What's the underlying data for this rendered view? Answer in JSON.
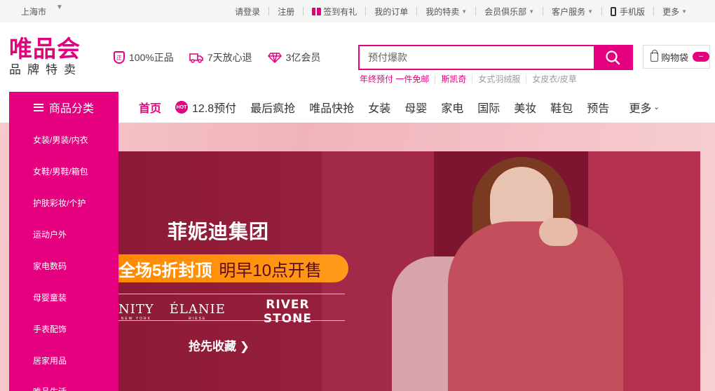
{
  "topbar": {
    "city": "上海市",
    "links": [
      {
        "label": "请登录"
      },
      {
        "label": "注册"
      },
      {
        "label": "签到有礼",
        "icon": "gift-icon"
      },
      {
        "label": "我的订单"
      },
      {
        "label": "我的特卖",
        "dropdown": true
      },
      {
        "label": "会员俱乐部",
        "dropdown": true
      },
      {
        "label": "客户服务",
        "dropdown": true
      },
      {
        "label": "手机版",
        "icon": "phone-icon"
      },
      {
        "label": "更多",
        "dropdown": true
      }
    ]
  },
  "logo": {
    "line1": "唯品会",
    "line2": "品牌特卖"
  },
  "promises": [
    {
      "label": "100%正品",
      "icon": "shield-badge-icon",
      "badge_text": "正"
    },
    {
      "label": "7天放心退",
      "icon": "truck-icon"
    },
    {
      "label": "3亿会员",
      "icon": "diamond-icon"
    }
  ],
  "search": {
    "placeholder": "预付爆款",
    "hotwords": [
      {
        "label": "年终预付 一件免邮",
        "accent": true
      },
      {
        "label": "斯凯奇",
        "accent": true
      },
      {
        "label": "女式羽绒服",
        "accent": false
      },
      {
        "label": "女皮衣/皮草",
        "accent": false
      }
    ]
  },
  "cart": {
    "label": "购物袋",
    "count": "–"
  },
  "nav": {
    "category_button": "商品分类",
    "items": [
      {
        "label": "首页",
        "active": true
      },
      {
        "label": "12.8预付",
        "hot_icon": true,
        "hot_text": "HOT"
      },
      {
        "label": "最后疯抢"
      },
      {
        "label": "唯品快抢"
      },
      {
        "label": "女装"
      },
      {
        "label": "母婴"
      },
      {
        "label": "家电"
      },
      {
        "label": "国际"
      },
      {
        "label": "美妆"
      },
      {
        "label": "鞋包"
      },
      {
        "label": "预告"
      },
      {
        "label": "更多",
        "dropdown": true
      }
    ]
  },
  "categories": [
    "女装/男装/内衣",
    "女鞋/男鞋/箱包",
    "护肤彩妆/个护",
    "运动户外",
    "家电数码",
    "母婴童装",
    "手表配饰",
    "居家用品",
    "唯品生活"
  ],
  "banner": {
    "title": "菲妮迪集团",
    "promo_strong": "全场5折封顶",
    "promo_text": "明早10点开售",
    "brands": [
      {
        "name": "NITY",
        "sub": "NEW YORK"
      },
      {
        "name": "ÉLANIE",
        "sub": "RIESE"
      },
      {
        "name": "RIVER STONE",
        "sub": ""
      }
    ],
    "cta": "抢先收藏 ❯"
  },
  "colors": {
    "accent": "#e4007f",
    "promo": "#ff8a00",
    "banner_bg": "#8a1c36"
  }
}
